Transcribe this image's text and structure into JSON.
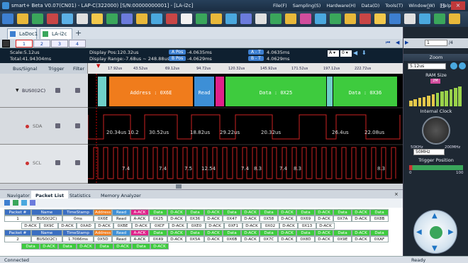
{
  "window": {
    "title": "smart+ Beta V0.07(CN01) - LAP-C(322000) [S/N:00000000001] - [LA-i2c]",
    "menu": [
      "File(F)",
      "Sampling(S)",
      "Hardware(H)",
      "Data(D)",
      "Tools(T)",
      "Window(W)",
      "Help(H)"
    ],
    "min": "_",
    "max": "□",
    "close": "×"
  },
  "toolbar_colors": [
    "#3d7fd0",
    "#e8b83a",
    "#3aa65b",
    "#c84646",
    "#5bb0e6",
    "#e0e0e0",
    "#f2c84b",
    "#3aa65b",
    "#6b7bdc",
    "#e8b83a",
    "#4aa8de",
    "#c84646",
    "#f2f2f2",
    "#3aa65b",
    "#e8b83a",
    "#4aa8de",
    "#6b7bdc",
    "#e0e0e0",
    "#3aa65b",
    "#e8b83a",
    "#d14d9c",
    "#4aa8de",
    "#3aa65b",
    "#e8b83a",
    "#c84646",
    "#f2c84b",
    "#3d7fd0",
    "#e0e0e0",
    "#4aa8de",
    "#3aa65b",
    "#e8b83a"
  ],
  "tabs": [
    {
      "label": "LaDoc1"
    },
    {
      "label": "LA-i2c"
    }
  ],
  "pages": {
    "items": [
      "1",
      "2",
      "3",
      "4"
    ],
    "total": "/4",
    "current": "1"
  },
  "info": {
    "scale": "Scale:5.12us",
    "total": "Total:41.94304ms",
    "disp_pos": "Display Pos:120.32us",
    "disp_range": "Display Range:-7.68us ~ 248.88us",
    "a_pos_label": "A Pos",
    "a_pos": "-4.0635ms",
    "b_pos_label": "B Pos",
    "a_minus_t_label": "A - T",
    "a_minus_t": "4.0635ms",
    "b_minus_t_label": "B - T",
    "b_minus_t": "4.0629ms",
    "b_pos": "-4.0629ms"
  },
  "bus_header": {
    "name": "Bus/Signal",
    "trigger": "Trigger",
    "filter": "Filter"
  },
  "ruler": [
    "17.92us",
    "43.52us",
    "69.12us",
    "94.72us",
    "120.32us",
    "145.92us",
    "171.52us",
    "197.12us",
    "222.72us"
  ],
  "signals": [
    {
      "label": "BUS0(I2C)"
    },
    {
      "label": "SDA"
    },
    {
      "label": "SCL"
    }
  ],
  "bus_segments": [
    {
      "label": "Address : 0X6E"
    },
    {
      "label": "Read"
    },
    {
      "label": "Data : 0X25"
    },
    {
      "label": "Data : 0X36"
    }
  ],
  "sda_labels": [
    "20.34us",
    "10.2",
    "30.52us",
    "18.82us",
    "29.22us",
    "20.32us",
    "26.4us",
    "22.08us"
  ],
  "scl_labels": [
    "7.4",
    "7.4",
    "7.5",
    "12.54",
    "7.4",
    "8.3",
    "7.4",
    "8.3",
    "8.3"
  ],
  "bottom_tabs": [
    "Navigator",
    "Packet List",
    "Statistics",
    "Memory Analyzer"
  ],
  "packet_headers": [
    "Packet #",
    "Name",
    "TimeStamp",
    "Address",
    "Read",
    "A-ACK",
    "Data",
    "D-ACK",
    "Data",
    "D-ACK",
    "Data",
    "D-ACK",
    "Data",
    "D-ACK",
    "Data",
    "D-ACK",
    "Data",
    "D-ACK",
    "Data",
    "D-ACK",
    "Data",
    "D-ACK"
  ],
  "packet_row1": [
    "1",
    "BUS0(I2C)",
    "0ms",
    "0X6E",
    "Read",
    "A-ACK",
    "0X25",
    "D-ACK",
    "0X36",
    "D-ACK",
    "0X47",
    "D-ACK",
    "0X58",
    "D-ACK",
    "0X69",
    "D-ACK",
    "0X7A",
    "D-ACK",
    "0X8B"
  ],
  "packet_row1b": [
    "D-ACK",
    "0X9C",
    "D-ACK",
    "0XAD",
    "D-ACK",
    "0XBE",
    "D-ACK",
    "0XCF",
    "D-ACK",
    "0XE0",
    "D-ACK",
    "0XF1",
    "D-ACK",
    "0X02",
    "D-ACK",
    "0X13",
    "D-ACK"
  ],
  "packet_row2": [
    "2",
    "BUS0(I2C)",
    "1.7066ms",
    "0X5D",
    "Read",
    "A-ACK",
    "0X49",
    "D-ACK",
    "0X5A",
    "D-ACK",
    "0X6B",
    "D-ACK",
    "0X7C",
    "D-ACK",
    "0X8D",
    "D-ACK",
    "0X9E",
    "D-ACK",
    "0XAF"
  ],
  "status": {
    "left": "Connected",
    "right": "Ready"
  },
  "right": {
    "zoom_label": "Zoom",
    "zoom_value": "5.12us",
    "ram_label": "RAM Size",
    "ram_value": "2M",
    "clock_label": "Internal Clock",
    "clock_min": "50KHz",
    "clock_max": "200MHz",
    "clock_value": "50MHz",
    "trig_label": "Trigger Position",
    "trig_min": "0",
    "trig_max": "100"
  }
}
